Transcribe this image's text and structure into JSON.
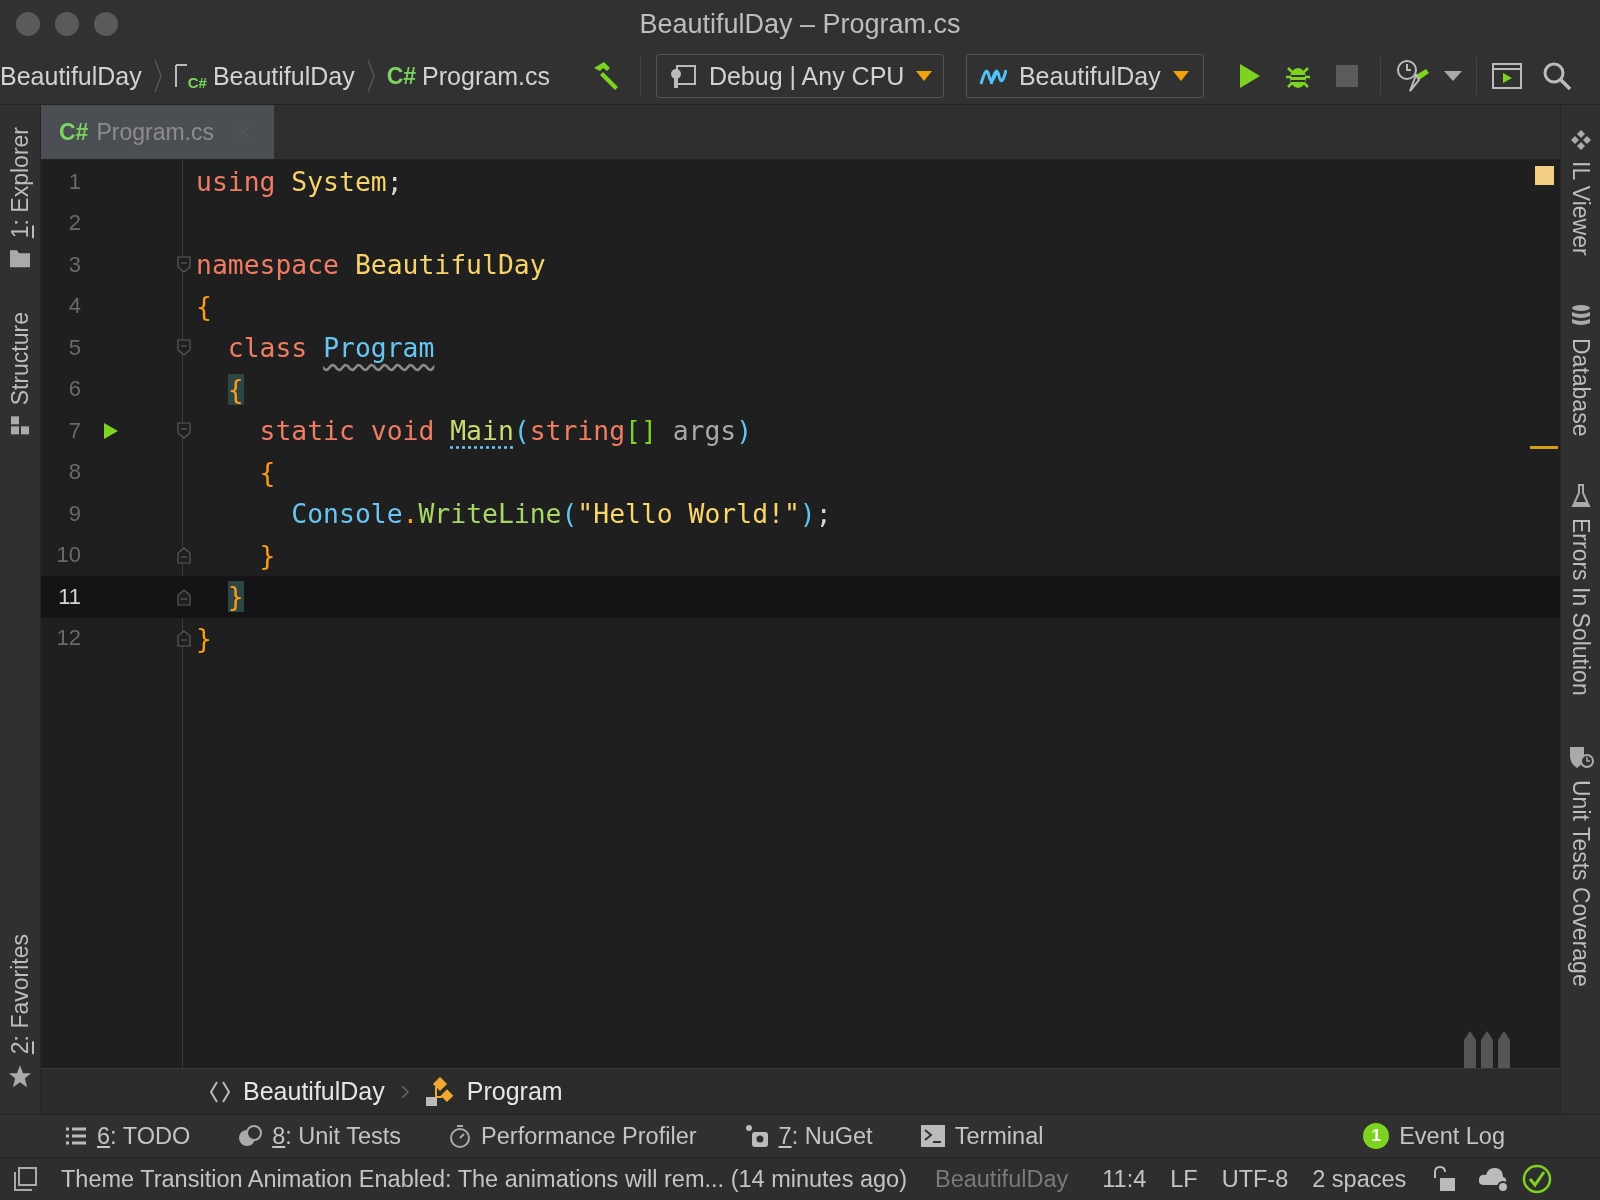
{
  "window": {
    "title": "BeautifulDay – Program.cs"
  },
  "navigation": [
    {
      "label": "BeautifulDay"
    },
    {
      "label": "BeautifulDay",
      "badge": "C#"
    },
    {
      "label": "Program.cs",
      "badge": "C#"
    }
  ],
  "build_config": {
    "value": "Debug | Any CPU"
  },
  "run_config": {
    "value": "BeautifulDay"
  },
  "stop_button": {
    "disabled": true
  },
  "tabs": [
    {
      "label": "Program.cs",
      "badge": "C#",
      "selected": true
    }
  ],
  "left_stripe": [
    {
      "mnemonic": "1",
      "label": ": Explorer"
    },
    {
      "label": "Structure"
    },
    {
      "mnemonic": "2",
      "label": ": Favorites"
    }
  ],
  "right_stripe": [
    {
      "label": "IL Viewer"
    },
    {
      "label": "Database"
    },
    {
      "label": "Errors In Solution"
    },
    {
      "label": "Unit Tests Coverage"
    }
  ],
  "editor": {
    "lines": [
      {
        "number": "1",
        "tokens": [
          {
            "kind": "keyword",
            "text": "using "
          },
          {
            "kind": "type",
            "text": "System"
          },
          {
            "kind": "punct",
            "text": ";"
          }
        ]
      },
      {
        "number": "2"
      },
      {
        "number": "3",
        "fold_open": true,
        "tokens": [
          {
            "kind": "keyword",
            "text": "namespace "
          },
          {
            "kind": "type",
            "text": "BeautifulDay"
          }
        ]
      },
      {
        "number": "4",
        "tokens": [
          {
            "kind": "brace",
            "text": "{"
          }
        ]
      },
      {
        "number": "5",
        "fold_open": true,
        "tokens": [
          {
            "kind": "keyword",
            "text": "  class "
          },
          {
            "kind": "class",
            "text": "Program",
            "wavy_underline": true
          }
        ]
      },
      {
        "number": "6",
        "tokens": [
          {
            "kind": "brace",
            "text": "  {",
            "highlighted": true
          }
        ]
      },
      {
        "number": "7",
        "fold_open": true,
        "runnable": true,
        "tokens": [
          {
            "kind": "keyword",
            "text": "    static void "
          },
          {
            "kind": "method",
            "text": "Main",
            "dotted_underline": true
          },
          {
            "kind": "paren",
            "text": "("
          },
          {
            "kind": "keyword",
            "text": "string"
          },
          {
            "kind": "bracket",
            "text": "[]"
          },
          {
            "kind": "param",
            "text": " args"
          },
          {
            "kind": "paren",
            "text": ")"
          }
        ]
      },
      {
        "number": "8",
        "tokens": [
          {
            "kind": "brace",
            "text": "    {"
          }
        ]
      },
      {
        "number": "9",
        "tokens": [
          {
            "kind": "class",
            "text": "      Console"
          },
          {
            "kind": "brace",
            "text": "."
          },
          {
            "kind": "call",
            "text": "WriteLine"
          },
          {
            "kind": "paren",
            "text": "("
          },
          {
            "kind": "string",
            "text": "\"Hello World!\""
          },
          {
            "kind": "paren",
            "text": ")"
          },
          {
            "kind": "punct",
            "text": ";"
          }
        ]
      },
      {
        "number": "10",
        "fold_close": true,
        "tokens": [
          {
            "kind": "brace",
            "text": "    }"
          }
        ]
      },
      {
        "number": "11",
        "fold_close": true,
        "current": true,
        "tokens": [
          {
            "kind": "brace",
            "text": "  }",
            "highlighted": true
          }
        ]
      },
      {
        "number": "12",
        "fold_close": true,
        "tokens": [
          {
            "kind": "brace",
            "text": "}"
          }
        ]
      }
    ]
  },
  "breadcrumbs": [
    {
      "label": "BeautifulDay"
    },
    {
      "label": "Program"
    }
  ],
  "tool_windows": [
    {
      "mnemonic": "6",
      "label": ": TODO"
    },
    {
      "mnemonic": "8",
      "label": ": Unit Tests"
    },
    {
      "label": "Performance Profiler"
    },
    {
      "mnemonic": "7",
      "label": ": NuGet"
    },
    {
      "label": "Terminal"
    }
  ],
  "event_log": {
    "label": "Event Log",
    "count": "1"
  },
  "status_bar": {
    "message": "Theme Transition Animation Enabled: The animations will rem... (14 minutes ago)",
    "project": "BeautifulDay",
    "position": "11:4",
    "line_separator": "LF",
    "encoding": "UTF-8",
    "indent": "2 spaces"
  }
}
